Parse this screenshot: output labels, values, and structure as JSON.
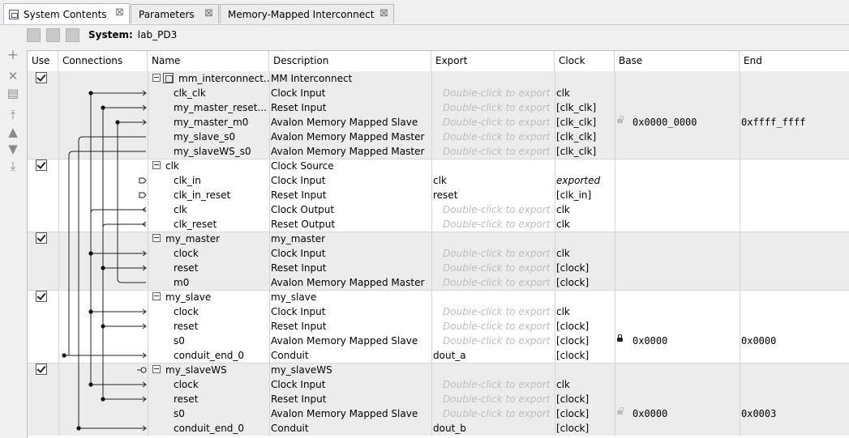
{
  "tabs": [
    {
      "label": "System Contents",
      "active": true
    },
    {
      "label": "Parameters",
      "active": false
    },
    {
      "label": "Memory-Mapped Interconnect",
      "active": false
    }
  ],
  "system": {
    "label": "System:",
    "name": "lab_PD3"
  },
  "columns": [
    "Use",
    "Connections",
    "Name",
    "Description",
    "Export",
    "Clock",
    "Base",
    "End"
  ],
  "export_hint": "Double-click to export",
  "groups": [
    {
      "use": true,
      "rows": [
        {
          "name": "mm_interconnect...",
          "desc": "MM Interconnect",
          "export": "",
          "clock": "",
          "base": "",
          "end": "",
          "icon": "mm-interconnect-icon"
        },
        {
          "name": "clk_clk",
          "desc": "Clock Input",
          "export": "hint",
          "clock": "clk"
        },
        {
          "name": "my_master_reset...",
          "desc": "Reset Input",
          "export": "hint",
          "clock": "[clk_clk]"
        },
        {
          "name": "my_master_m0",
          "desc": "Avalon Memory Mapped Slave",
          "export": "hint",
          "clock": "[clk_clk]",
          "base": "0x0000_0000",
          "end": "0xffff_ffff",
          "lock": "open"
        },
        {
          "name": "my_slave_s0",
          "desc": "Avalon Memory Mapped Master",
          "export": "hint",
          "clock": "[clk_clk]"
        },
        {
          "name": "my_slaveWS_s0",
          "desc": "Avalon Memory Mapped Master",
          "export": "hint",
          "clock": "[clk_clk]"
        }
      ]
    },
    {
      "use": true,
      "rows": [
        {
          "name": "clk",
          "desc": "Clock Source",
          "export": "",
          "clock": ""
        },
        {
          "name": "clk_in",
          "desc": "Clock Input",
          "export": "clk",
          "clock": "exported",
          "clock_italic": true
        },
        {
          "name": "clk_in_reset",
          "desc": "Reset Input",
          "export": "reset",
          "clock": "[clk_in]"
        },
        {
          "name": "clk",
          "desc": "Clock Output",
          "export": "hint",
          "clock": "clk"
        },
        {
          "name": "clk_reset",
          "desc": "Reset Output",
          "export": "hint",
          "clock": "clk"
        }
      ]
    },
    {
      "use": true,
      "rows": [
        {
          "name": "my_master",
          "desc": "my_master",
          "export": "",
          "clock": ""
        },
        {
          "name": "clock",
          "desc": "Clock Input",
          "export": "hint",
          "clock": "clk"
        },
        {
          "name": "reset",
          "desc": "Reset Input",
          "export": "hint",
          "clock": "[clock]"
        },
        {
          "name": "m0",
          "desc": "Avalon Memory Mapped Master",
          "export": "hint",
          "clock": "[clock]"
        }
      ]
    },
    {
      "use": true,
      "rows": [
        {
          "name": "my_slave",
          "desc": "my_slave",
          "export": "",
          "clock": ""
        },
        {
          "name": "clock",
          "desc": "Clock Input",
          "export": "hint",
          "clock": "clk"
        },
        {
          "name": "reset",
          "desc": "Reset Input",
          "export": "hint",
          "clock": "[clock]"
        },
        {
          "name": "s0",
          "desc": "Avalon Memory Mapped Slave",
          "export": "hint",
          "clock": "[clock]",
          "base": "0x0000",
          "end": "0x0000",
          "lock": "closed"
        },
        {
          "name": "conduit_end_0",
          "desc": "Conduit",
          "export": "dout_a",
          "clock": "[clock]"
        }
      ]
    },
    {
      "use": true,
      "rows": [
        {
          "name": "my_slaveWS",
          "desc": "my_slaveWS",
          "export": "",
          "clock": ""
        },
        {
          "name": "clock",
          "desc": "Clock Input",
          "export": "hint",
          "clock": "clk"
        },
        {
          "name": "reset",
          "desc": "Reset Input",
          "export": "hint",
          "clock": "[clock]"
        },
        {
          "name": "s0",
          "desc": "Avalon Memory Mapped Slave",
          "export": "hint",
          "clock": "[clock]",
          "base": "0x0000",
          "end": "0x0003",
          "lock": "open"
        },
        {
          "name": "conduit_end_0",
          "desc": "Conduit",
          "export": "dout_b",
          "clock": "[clock]"
        }
      ]
    }
  ]
}
